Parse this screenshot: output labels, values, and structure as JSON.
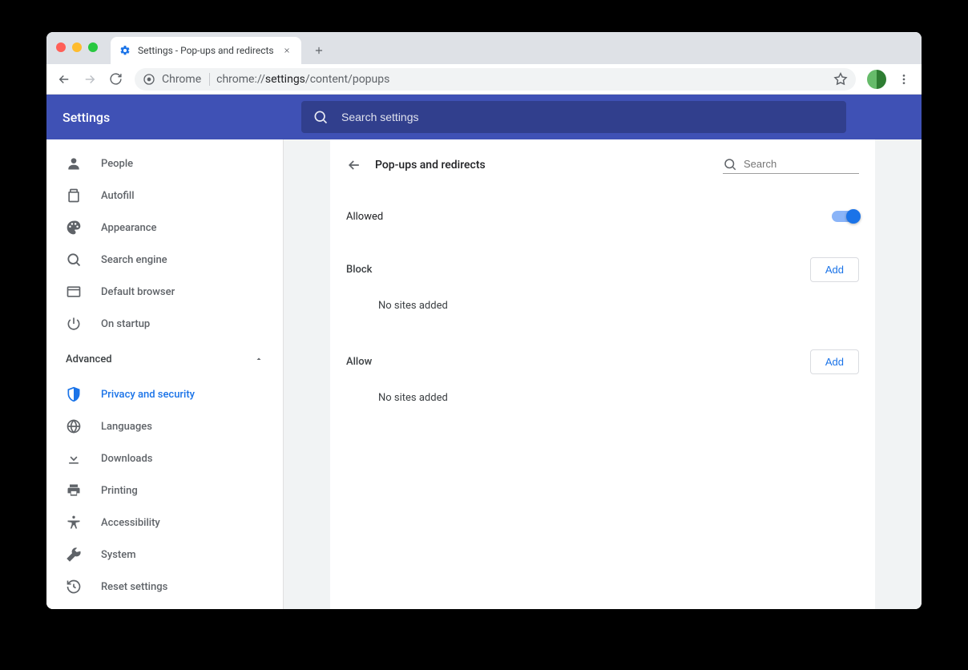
{
  "tab": {
    "title": "Settings - Pop-ups and redirects"
  },
  "omnibox": {
    "chrome_label": "Chrome",
    "url_prefix": "chrome://",
    "url_bold": "settings",
    "url_suffix": "/content/popups"
  },
  "header": {
    "title": "Settings",
    "search_placeholder": "Search settings"
  },
  "sidebar": {
    "items": [
      {
        "label": "People"
      },
      {
        "label": "Autofill"
      },
      {
        "label": "Appearance"
      },
      {
        "label": "Search engine"
      },
      {
        "label": "Default browser"
      },
      {
        "label": "On startup"
      }
    ],
    "advanced_label": "Advanced",
    "advanced_items": [
      {
        "label": "Privacy and security",
        "active": true
      },
      {
        "label": "Languages"
      },
      {
        "label": "Downloads"
      },
      {
        "label": "Printing"
      },
      {
        "label": "Accessibility"
      },
      {
        "label": "System"
      },
      {
        "label": "Reset settings"
      }
    ]
  },
  "page": {
    "title": "Pop-ups and redirects",
    "search_placeholder": "Search",
    "allowed_label": "Allowed",
    "block_label": "Block",
    "allow_label": "Allow",
    "add_label": "Add",
    "empty_text": "No sites added"
  }
}
